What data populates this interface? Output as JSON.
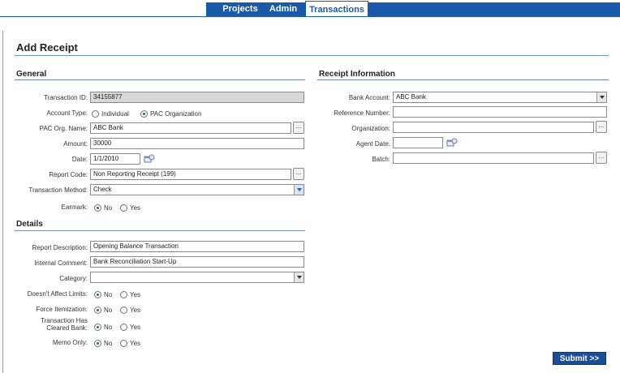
{
  "nav": {
    "tabs": [
      {
        "label": "Projects"
      },
      {
        "label": "Admin"
      },
      {
        "label": "Transactions"
      }
    ]
  },
  "page": {
    "title": "Add Receipt"
  },
  "general": {
    "heading": "General",
    "transaction_id": {
      "label": "Transaction ID:",
      "value": "34155877"
    },
    "account_type": {
      "label": "Account Type:",
      "options": [
        "Individual",
        "PAC Organization"
      ],
      "selected": "PAC Organization"
    },
    "pac_org_name": {
      "label": "PAC Org. Name:",
      "value": "ABC Bank",
      "button": "..."
    },
    "amount": {
      "label": "Amount:",
      "value": "30000"
    },
    "date": {
      "label": "Date:",
      "value": "1/1/2010"
    },
    "report_code": {
      "label": "Report Code:",
      "value": "Non Reporting Receipt (199)",
      "button": "..."
    },
    "transaction_method": {
      "label": "Transaction Method:",
      "value": "Check"
    },
    "earmark": {
      "label": "Earmark:",
      "options": [
        "No",
        "Yes"
      ],
      "selected": "No"
    }
  },
  "details": {
    "heading": "Details",
    "report_description": {
      "label": "Report Description:",
      "value": "Opening Balance Transaction"
    },
    "internal_comment": {
      "label": "Internal Comment:",
      "value": "Bank Reconciliation Start-Up"
    },
    "category": {
      "label": "Category:",
      "value": ""
    },
    "doesnt_affect_limits": {
      "label": "Doesn't Affect Limits:",
      "options": [
        "No",
        "Yes"
      ],
      "selected": "No"
    },
    "force_itemization": {
      "label": "Force Itemization:",
      "options": [
        "No",
        "Yes"
      ],
      "selected": "No"
    },
    "cleared_bank": {
      "label": "Transaction Has Cleared Bank:",
      "options": [
        "No",
        "Yes"
      ],
      "selected": "No"
    },
    "memo_only": {
      "label": "Memo Only:",
      "options": [
        "No",
        "Yes"
      ],
      "selected": "No"
    }
  },
  "receipt_info": {
    "heading": "Receipt Information",
    "bank_account": {
      "label": "Bank Account:",
      "value": "ABC Bank"
    },
    "reference_number": {
      "label": "Reference Number:",
      "value": ""
    },
    "organization": {
      "label": "Organization:",
      "value": "",
      "button": "..."
    },
    "agent_date": {
      "label": "Agent Date:",
      "value": ""
    },
    "batch": {
      "label": "Batch:",
      "value": "",
      "button": "..."
    }
  },
  "actions": {
    "submit_label": "Submit >>"
  },
  "colors": {
    "nav_band": "#1a5aa8",
    "submit_bg": "#1a4f98",
    "readonly_bg": "#d8d8d8"
  },
  "icons": {
    "calendar": "calendar-icon",
    "ellipsis": "ellipsis-icon",
    "dropdown": "chevron-down-icon"
  }
}
